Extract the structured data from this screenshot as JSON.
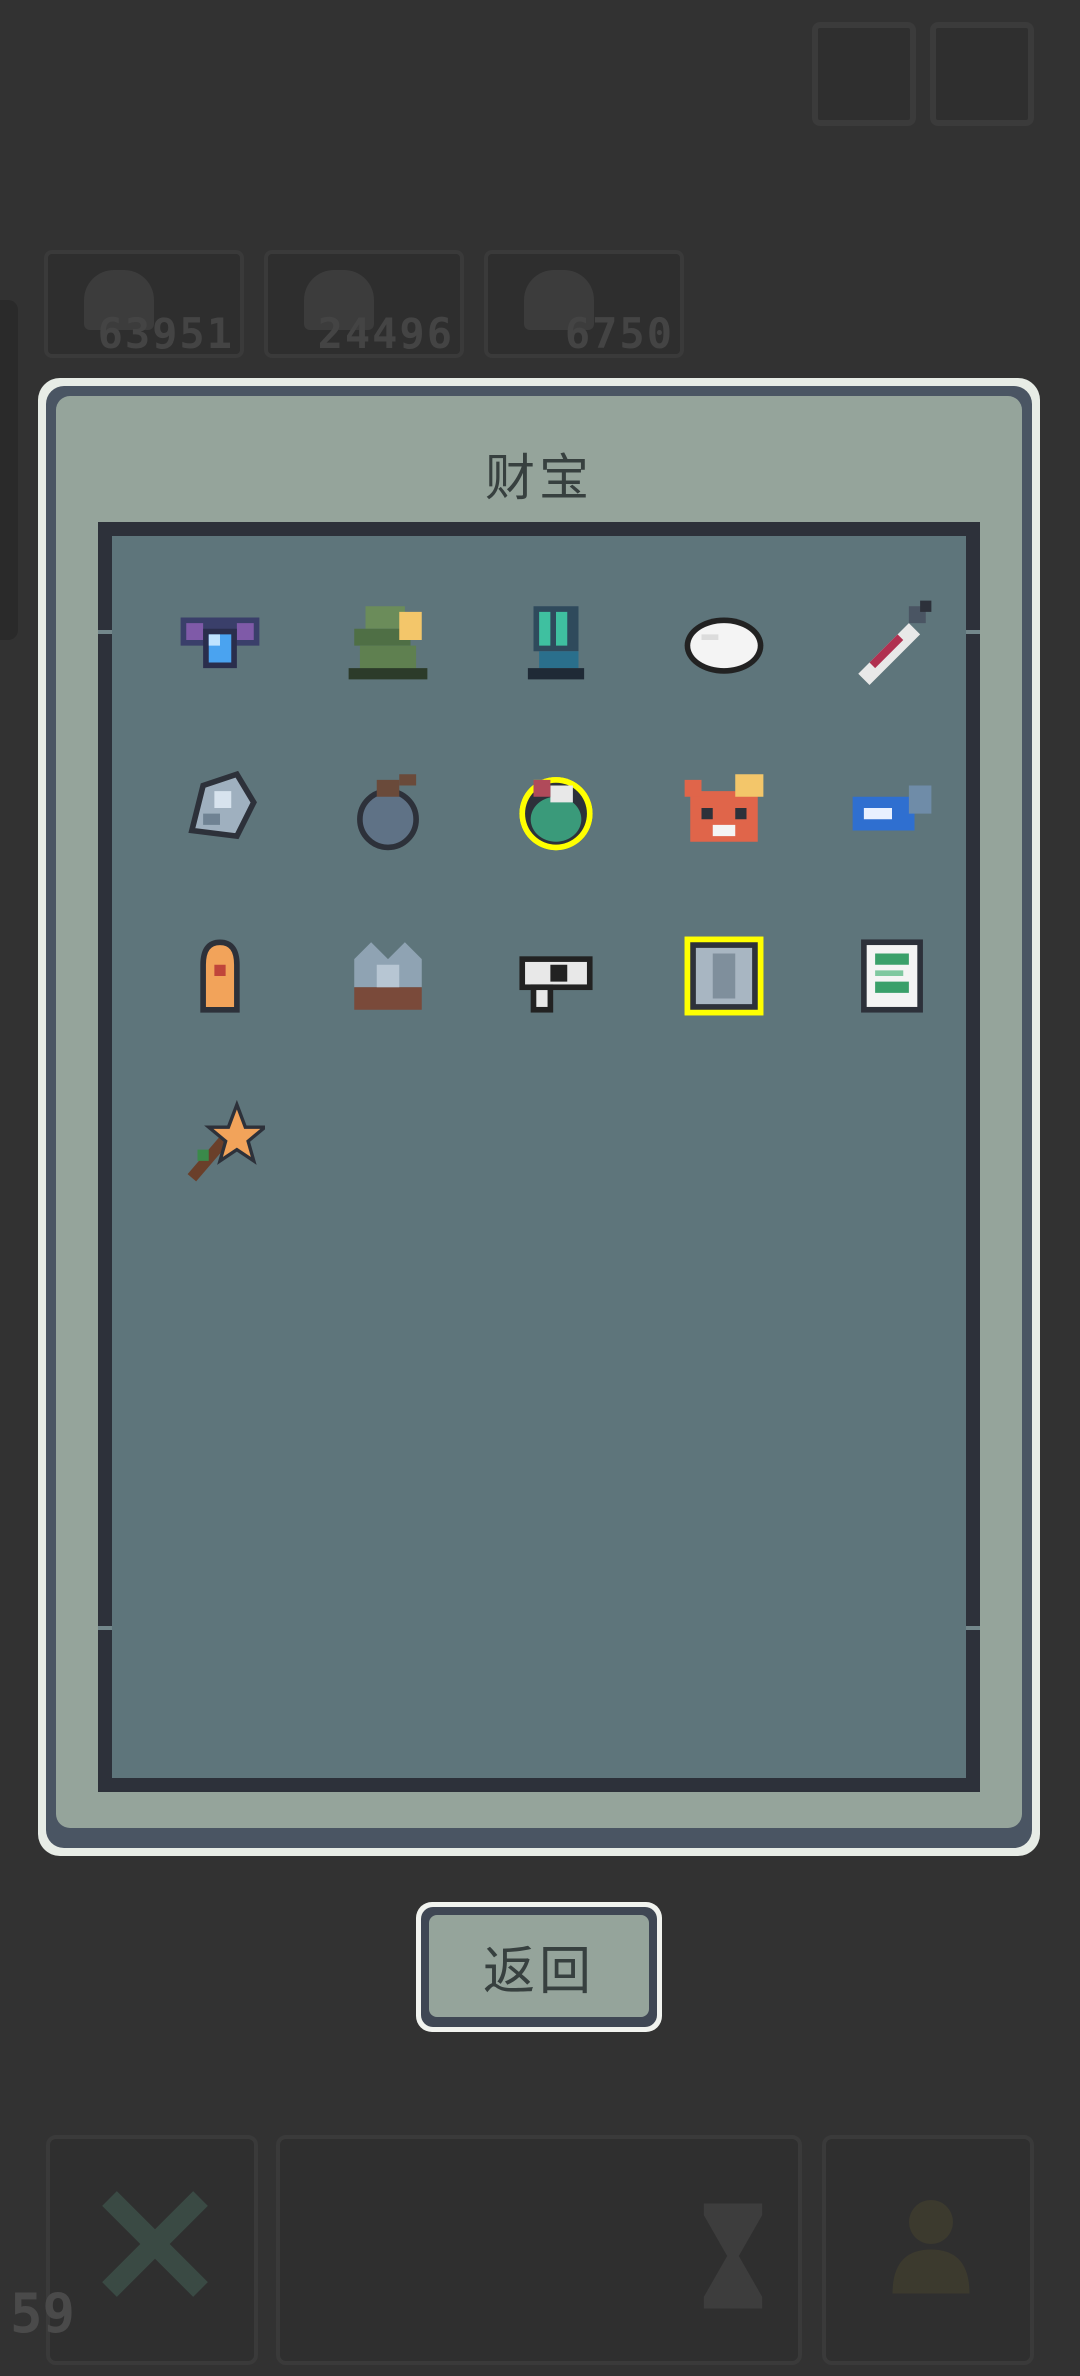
{
  "hud": {
    "resources": [
      {
        "value": "63951",
        "icon": "resource-icon"
      },
      {
        "value": "24496",
        "icon": "resource-icon"
      },
      {
        "value": "6750",
        "icon": "resource-icon"
      }
    ],
    "level": "59"
  },
  "modal": {
    "title": "财宝",
    "items": [
      {
        "name": "blue-orb-amulet-icon",
        "highlighted": false
      },
      {
        "name": "green-helmet-icon",
        "highlighted": false
      },
      {
        "name": "armored-glove-icon",
        "highlighted": false
      },
      {
        "name": "white-dumpling-icon",
        "highlighted": false
      },
      {
        "name": "syringe-icon",
        "highlighted": false
      },
      {
        "name": "crystal-ore-icon",
        "highlighted": false
      },
      {
        "name": "grenade-icon",
        "highlighted": false
      },
      {
        "name": "green-potion-icon",
        "highlighted": true
      },
      {
        "name": "red-panda-mask-icon",
        "highlighted": false
      },
      {
        "name": "blue-ticket-icon",
        "highlighted": false
      },
      {
        "name": "orange-bullet-icon",
        "highlighted": false
      },
      {
        "name": "spiked-armor-icon",
        "highlighted": false
      },
      {
        "name": "eye-key-icon",
        "highlighted": false
      },
      {
        "name": "stone-tablet-icon",
        "highlighted": true
      },
      {
        "name": "scroll-icon",
        "highlighted": false
      },
      {
        "name": "star-wand-icon",
        "highlighted": false
      }
    ]
  },
  "back_button": {
    "label": "返回"
  },
  "colors": {
    "background": "#323232",
    "panel": "#95a49b",
    "inner": "#5e757b",
    "highlight": "#ffff00"
  }
}
